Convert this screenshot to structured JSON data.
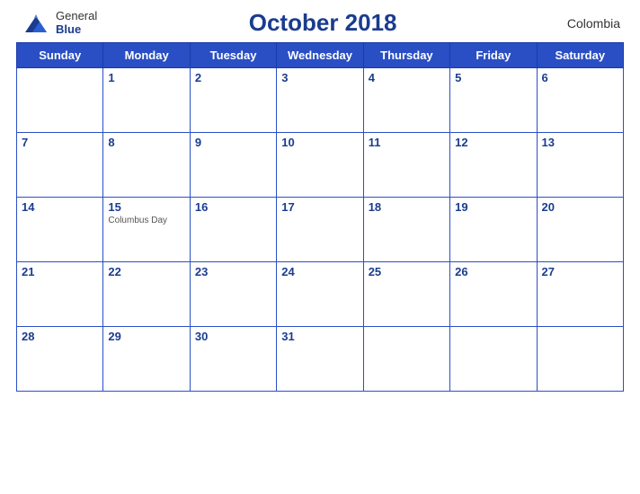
{
  "header": {
    "logo_general": "General",
    "logo_blue": "Blue",
    "title": "October 2018",
    "country": "Colombia"
  },
  "calendar": {
    "days": [
      "Sunday",
      "Monday",
      "Tuesday",
      "Wednesday",
      "Thursday",
      "Friday",
      "Saturday"
    ],
    "weeks": [
      [
        {
          "date": "",
          "event": ""
        },
        {
          "date": "1",
          "event": ""
        },
        {
          "date": "2",
          "event": ""
        },
        {
          "date": "3",
          "event": ""
        },
        {
          "date": "4",
          "event": ""
        },
        {
          "date": "5",
          "event": ""
        },
        {
          "date": "6",
          "event": ""
        }
      ],
      [
        {
          "date": "7",
          "event": ""
        },
        {
          "date": "8",
          "event": ""
        },
        {
          "date": "9",
          "event": ""
        },
        {
          "date": "10",
          "event": ""
        },
        {
          "date": "11",
          "event": ""
        },
        {
          "date": "12",
          "event": ""
        },
        {
          "date": "13",
          "event": ""
        }
      ],
      [
        {
          "date": "14",
          "event": ""
        },
        {
          "date": "15",
          "event": "Columbus Day"
        },
        {
          "date": "16",
          "event": ""
        },
        {
          "date": "17",
          "event": ""
        },
        {
          "date": "18",
          "event": ""
        },
        {
          "date": "19",
          "event": ""
        },
        {
          "date": "20",
          "event": ""
        }
      ],
      [
        {
          "date": "21",
          "event": ""
        },
        {
          "date": "22",
          "event": ""
        },
        {
          "date": "23",
          "event": ""
        },
        {
          "date": "24",
          "event": ""
        },
        {
          "date": "25",
          "event": ""
        },
        {
          "date": "26",
          "event": ""
        },
        {
          "date": "27",
          "event": ""
        }
      ],
      [
        {
          "date": "28",
          "event": ""
        },
        {
          "date": "29",
          "event": ""
        },
        {
          "date": "30",
          "event": ""
        },
        {
          "date": "31",
          "event": ""
        },
        {
          "date": "",
          "event": ""
        },
        {
          "date": "",
          "event": ""
        },
        {
          "date": "",
          "event": ""
        }
      ]
    ]
  }
}
